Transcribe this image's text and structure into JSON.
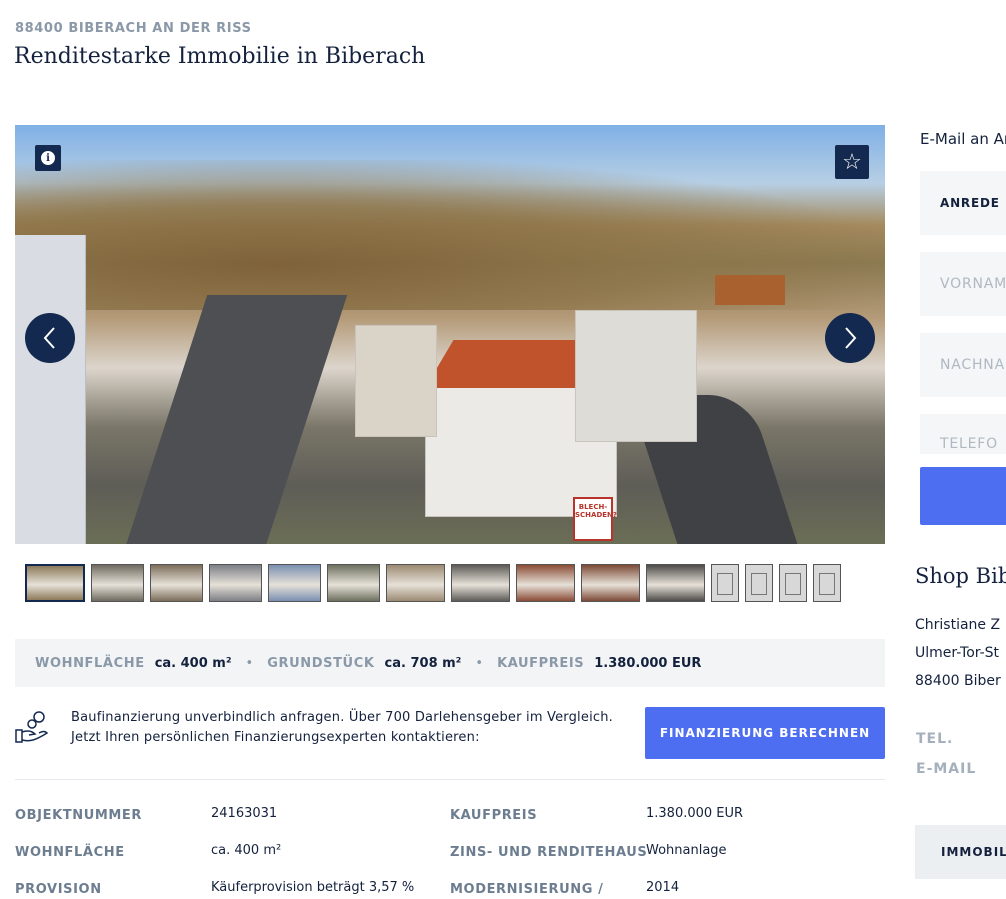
{
  "header": {
    "location": "88400 BIBERACH AN DER RISS",
    "title": "Renditestarke Immobilie in Biberach"
  },
  "gallery": {
    "sign_text": "BLECH-SCHADEN?",
    "thumbnail_count": 15,
    "thumbnails": [
      {
        "kind": "photo",
        "color": "#8d7a5a"
      },
      {
        "kind": "photo",
        "color": "#6f6a5f"
      },
      {
        "kind": "photo",
        "color": "#7b6d5a"
      },
      {
        "kind": "photo",
        "color": "#7c7f86"
      },
      {
        "kind": "photo",
        "color": "#7a8fb0"
      },
      {
        "kind": "photo",
        "color": "#6d705f"
      },
      {
        "kind": "photo",
        "color": "#9c8a72"
      },
      {
        "kind": "photo",
        "color": "#5e5a57"
      },
      {
        "kind": "photo",
        "color": "#8a4c35"
      },
      {
        "kind": "photo",
        "color": "#7d4a36"
      },
      {
        "kind": "photo",
        "color": "#4d4c4a"
      },
      {
        "kind": "plan",
        "color": "#d8d8d8"
      },
      {
        "kind": "plan",
        "color": "#d8d8d8"
      },
      {
        "kind": "plan",
        "color": "#d8d8d8"
      },
      {
        "kind": "plan",
        "color": "#d8d8d8"
      }
    ]
  },
  "facts": {
    "wohnflaeche_label": "WOHNFLÄCHE",
    "wohnflaeche_value": "ca. 400 m²",
    "grundstueck_label": "GRUNDSTÜCK",
    "grundstueck_value": "ca. 708 m²",
    "kaufpreis_label": "KAUFPREIS",
    "kaufpreis_value": "1.380.000 EUR",
    "separator": "•"
  },
  "finance": {
    "line1": "Baufinanzierung unverbindlich anfragen. Über 700 Darlehensgeber im Vergleich.",
    "line2": "Jetzt Ihren persönlichen Finanzierungsexperten kontaktieren:",
    "button": "FINANZIERUNG BERECHNEN"
  },
  "details": {
    "objektnummer_label": "OBJEKTNUMMER",
    "objektnummer_value": "24163031",
    "wohnflaeche_label": "WOHNFLÄCHE",
    "wohnflaeche_value": "ca. 400 m²",
    "provision_label": "PROVISION",
    "provision_value": "Käuferprovision beträgt 3,57 %",
    "kaufpreis_label": "KAUFPREIS",
    "kaufpreis_value": "1.380.000 EUR",
    "typ_label": "ZINS- UND RENDITEHAUS",
    "typ_value": "Wohnanlage",
    "modernisierung_label": "MODERNISIERUNG /",
    "modernisierung_value": "2014"
  },
  "contact_form": {
    "title": "E-Mail an Ar",
    "anrede": "ANREDE",
    "vorname_placeholder": "VORNAM",
    "nachname_placeholder": "NACHNA",
    "telefon_placeholder": "TELEFO"
  },
  "shop": {
    "title": "Shop Bib",
    "name": "Christiane Z",
    "street": "Ulmer-Tor-St",
    "city": "88400 Biber",
    "tel_label": "TEL.",
    "email_label": "E-MAIL",
    "button": "IMMOBILI"
  },
  "colors": {
    "navy": "#14294f",
    "accent": "#4e6ef2",
    "muted": "#8a98a8"
  }
}
